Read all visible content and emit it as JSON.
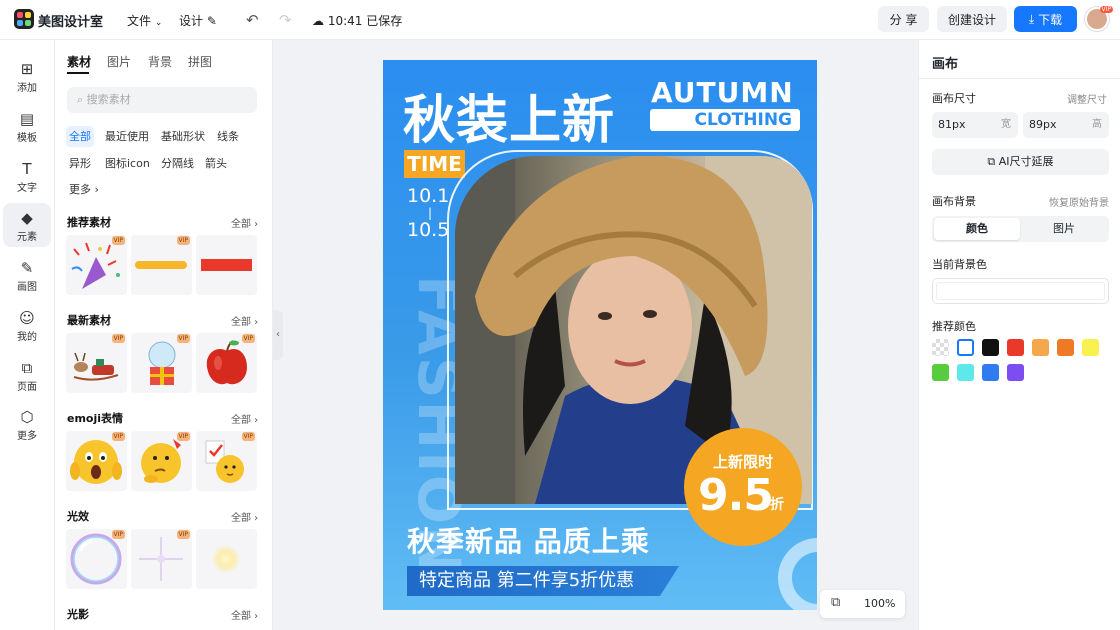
{
  "app": {
    "name": "美图设计室"
  },
  "topbar": {
    "file_label": "文件",
    "design_label": "设计",
    "save_status": "10:41 已保存",
    "share_label": "分 享",
    "create_label": "创建设计",
    "download_label": "下载",
    "avatar_badge": "VIP"
  },
  "rail": [
    {
      "label": "添加",
      "icon": "plus-square"
    },
    {
      "label": "模板",
      "icon": "template"
    },
    {
      "label": "文字",
      "icon": "text"
    },
    {
      "label": "元素",
      "icon": "shapes"
    },
    {
      "label": "画图",
      "icon": "draw"
    },
    {
      "label": "我的",
      "icon": "user"
    },
    {
      "label": "页面",
      "icon": "page-add"
    },
    {
      "label": "更多",
      "icon": "cube"
    }
  ],
  "panel": {
    "tabs": [
      "素材",
      "图片",
      "背景",
      "拼图"
    ],
    "search_placeholder": "搜索素材",
    "chips": [
      "全部",
      "最近使用",
      "基础形状",
      "线条",
      "异形",
      "图标icon",
      "分隔线",
      "箭头",
      "更多"
    ],
    "sections": [
      {
        "title": "推荐素材",
        "all": "全部"
      },
      {
        "title": "最新素材",
        "all": "全部"
      },
      {
        "title": "emoji表情",
        "all": "全部"
      },
      {
        "title": "光效",
        "all": "全部"
      },
      {
        "title": "光影",
        "all": "全部"
      }
    ],
    "vip_label": "VIP"
  },
  "poster": {
    "title": "秋装上新",
    "autumn": "AUTUMN",
    "clothing": "CLOTHING",
    "time": "TIME",
    "date_start": "10.1",
    "date_sep": "|",
    "date_end": "10.5",
    "fashion": "FASHION",
    "badge_top": "上新限时",
    "badge_value": "9.5",
    "badge_unit": "折",
    "slogan": "秋季新品 品质上乘",
    "promo": "特定商品 第二件享5折优惠"
  },
  "zoom": {
    "level": "100%"
  },
  "right": {
    "title": "画布",
    "size_label": "画布尺寸",
    "size_adjust": "调整尺寸",
    "width_value": "81px",
    "width_unit": "宽",
    "height_value": "89px",
    "height_unit": "高",
    "ai_extend": "AI尺寸延展",
    "bg_label": "画布背景",
    "bg_restore": "恢复原始背景",
    "seg_color": "颜色",
    "seg_image": "图片",
    "current_bg": "当前背景色",
    "recommend": "推荐颜色",
    "colors": [
      "transparent",
      "#ffffff",
      "#111111",
      "#e8392a",
      "#f5a84b",
      "#ee7a26",
      "#f7f250",
      "#58cc3d",
      "#5fe8ea",
      "#2f7bf0",
      "#7c4df0"
    ]
  }
}
